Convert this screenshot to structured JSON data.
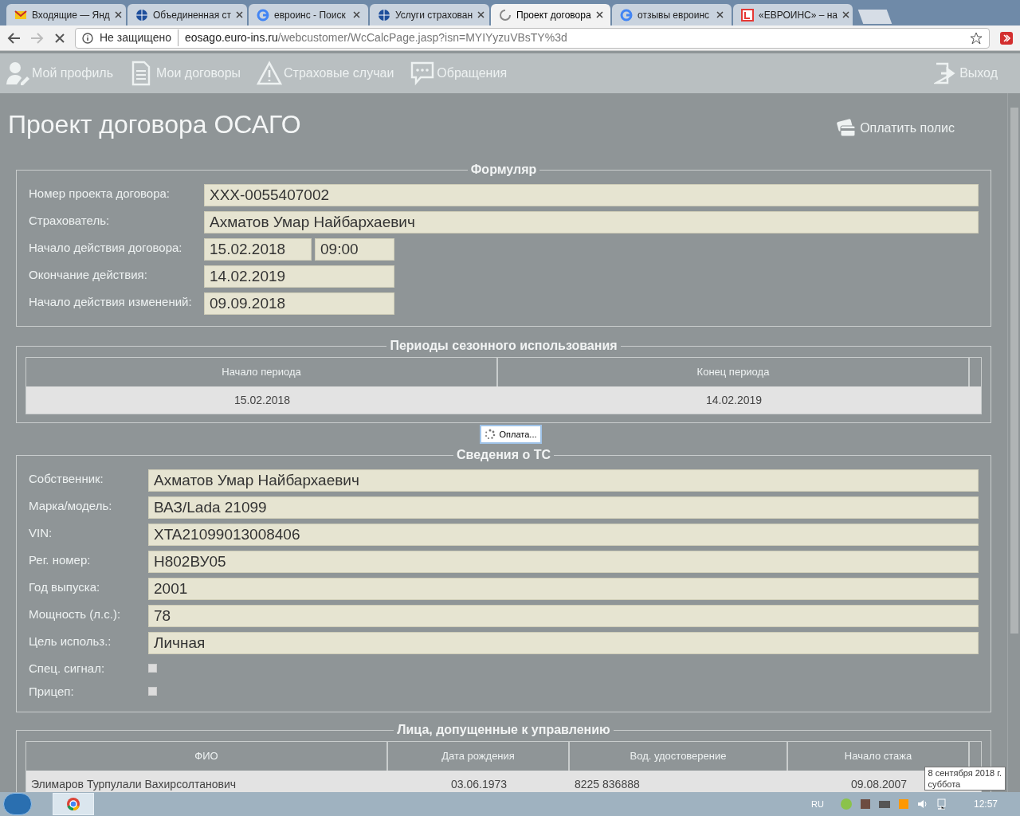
{
  "browser": {
    "tabs": [
      {
        "label": "Входящие — Янд",
        "selected": false
      },
      {
        "label": "Объединенная ст",
        "selected": false
      },
      {
        "label": "евроинс - Поиск",
        "selected": false
      },
      {
        "label": "Услуги страхован",
        "selected": false
      },
      {
        "label": "Проект договора",
        "selected": true
      },
      {
        "label": "отзывы евроинс",
        "selected": false
      },
      {
        "label": "«ЕВРОИНС» – на",
        "selected": false
      }
    ],
    "security": "Не защищено",
    "url_host": "eosago.euro-ins.ru",
    "url_path": "/webcustomer/WcCalcPage.jasp?isn=MYIYyzuVBsTY%3d"
  },
  "nav": {
    "items": [
      {
        "label": "Мой профиль"
      },
      {
        "label": "Мои договоры"
      },
      {
        "label": "Страховые случаи"
      },
      {
        "label": "Обращения"
      }
    ],
    "logout": "Выход"
  },
  "title": "Проект договора ОСАГО",
  "pay_button": "Оплатить полис",
  "formular": {
    "legend": "Формуляр",
    "fields": [
      {
        "label": "Номер проекта договора:",
        "values": [
          "XXX-0055407002"
        ]
      },
      {
        "label": "Страхователь:",
        "values": [
          "Ахматов Умар Найбархаевич"
        ]
      },
      {
        "label": "Начало действия договора:",
        "values": [
          "15.02.2018",
          "09:00"
        ]
      },
      {
        "label": "Окончание действия:",
        "values": [
          "14.02.2019"
        ]
      },
      {
        "label": "Начало действия изменений:",
        "values": [
          "09.09.2018"
        ]
      }
    ]
  },
  "seasons": {
    "legend": "Периоды сезонного использования",
    "columns": [
      "Начало периода",
      "Конец периода"
    ],
    "rows": [
      [
        "15.02.2018",
        "14.02.2019"
      ]
    ]
  },
  "loading": "Оплата...",
  "vehicle": {
    "legend": "Сведения о ТС",
    "fields": [
      {
        "kind": "text",
        "label": "Собственник:",
        "value": "Ахматов Умар Найбархаевич"
      },
      {
        "kind": "text",
        "label": "Марка/модель:",
        "value": "ВАЗ/Lada 21099"
      },
      {
        "kind": "text",
        "label": "VIN:",
        "value": "XTA21099013008406"
      },
      {
        "kind": "text",
        "label": "Рег. номер:",
        "value": "Н802ВУ05"
      },
      {
        "kind": "text",
        "label": "Год выпуска:",
        "value": "2001"
      },
      {
        "kind": "text",
        "label": "Мощность (л.с.):",
        "value": "78"
      },
      {
        "kind": "text",
        "label": "Цель использ.:",
        "value": "Личная"
      },
      {
        "kind": "checkbox",
        "label": "Спец. сигнал:",
        "checked": false
      },
      {
        "kind": "checkbox",
        "label": "Прицеп:",
        "checked": false
      }
    ]
  },
  "drivers": {
    "legend": "Лица, допущенные к управлению",
    "columns": [
      "ФИО",
      "Дата рождения",
      "Вод. удостоверение",
      "Начало стажа"
    ],
    "rows": [
      [
        "Элимаров Турпулали Вахирсолтанович",
        "03.06.1973",
        "8225 836888",
        "09.08.2007"
      ]
    ]
  },
  "taskbar": {
    "language": "RU",
    "clock": "12:57",
    "tooltip": [
      "8 сентября 2018 г.",
      "суббота"
    ]
  }
}
